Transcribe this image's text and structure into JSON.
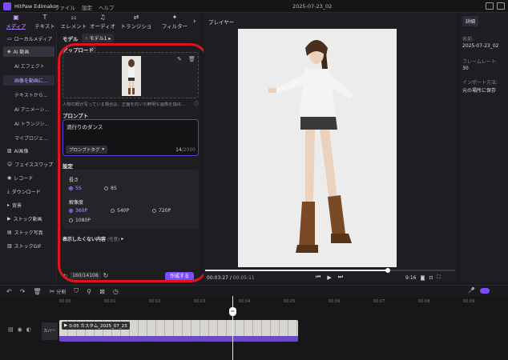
{
  "app": {
    "name": "HitPaw Edimakor",
    "menus": [
      "ファイル",
      "設定",
      "ヘルプ"
    ],
    "project_date": "2025-07-23_02"
  },
  "toolbar": {
    "tabs": [
      {
        "label": "メディア",
        "icon": "media-icon"
      },
      {
        "label": "テキスト",
        "icon": "text-icon"
      },
      {
        "label": "エレメント",
        "icon": "elements-icon"
      },
      {
        "label": "オーディオ",
        "icon": "audio-icon"
      },
      {
        "label": "トランジション",
        "icon": "transition-icon"
      },
      {
        "label": "フィルター",
        "icon": "filter-icon"
      }
    ]
  },
  "sidebar": {
    "items": [
      {
        "label": "ローカルメディア"
      },
      {
        "label": "AI 動画"
      },
      {
        "label": "AI エフェクト"
      },
      {
        "label": "画像を動画に..."
      },
      {
        "label": "テキストから..."
      },
      {
        "label": "AI アニメーシ..."
      },
      {
        "label": "AI トランジシ..."
      },
      {
        "label": "マイプロジェ..."
      },
      {
        "label": "AI画像"
      },
      {
        "label": "フェイススワップ"
      },
      {
        "label": "レコード"
      },
      {
        "label": "ダウンロード"
      },
      {
        "label": "背景"
      },
      {
        "label": "ストック動画"
      },
      {
        "label": "ストック写真"
      },
      {
        "label": "ストックGIF"
      }
    ]
  },
  "panel": {
    "model_label": "モデル",
    "model_value": "モデル1",
    "upload_label": "アップロード",
    "upload_hint": "人物の顔が写っている場合は、正面を向いた鮮明な画像を指出...",
    "prompt_label": "プロンプト",
    "prompt_text": "流行りのダンス",
    "prompt_tag_button": "プロンプトタグ",
    "prompt_count": "14",
    "prompt_max": "/2000",
    "settings_label": "設定",
    "length_label": "長さ",
    "length_options": [
      "5S",
      "8S"
    ],
    "length_selected": "5S",
    "resolution_label": "解像度",
    "resolution_options": [
      "360P",
      "540P",
      "720P",
      "1080P"
    ],
    "resolution_selected": "360P",
    "negative_label": "表示したくない内容",
    "negative_note": "(任意)",
    "credits": "160/14108",
    "generate_button": "作成する"
  },
  "player": {
    "title": "プレイヤー",
    "current_time": "00:03:27",
    "total_time": "00:05:11",
    "aspect": "9:16",
    "progress": 0.73
  },
  "details": {
    "tab": "詳細",
    "name_label": "名前:",
    "name_value": "2025-07-23_02",
    "framerate_label": "フレームレート:",
    "framerate_value": "30",
    "import_label": "インポート方法:",
    "import_value": "元の場所に保存"
  },
  "timeline": {
    "split_label": "分割",
    "ruler": [
      "00:00",
      "00:01",
      "00:02",
      "00:03",
      "00:04",
      "00:05",
      "00:06",
      "00:07",
      "00:08",
      "00:09"
    ],
    "track_label": "カバー",
    "clip_label": "0:05 カスタム_2025_07_23"
  }
}
